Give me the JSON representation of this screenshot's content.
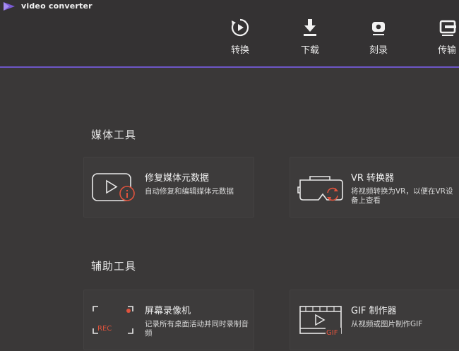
{
  "app": {
    "title": "video converter"
  },
  "toolbar": {
    "items": [
      {
        "label": "转换",
        "icon": "convert-icon"
      },
      {
        "label": "下载",
        "icon": "download-icon"
      },
      {
        "label": "刻录",
        "icon": "burn-disc-icon"
      },
      {
        "label": "传输",
        "icon": "transfer-icon"
      }
    ]
  },
  "sections": {
    "media": {
      "title": "媒体工具",
      "cards": [
        {
          "title": "修复媒体元数据",
          "desc": "自动修复和编辑媒体元数据",
          "icon": "fix-metadata-icon"
        },
        {
          "title": "VR 转换器",
          "desc": "将视频转换为VR，以便在VR设备上查看",
          "icon": "vr-headset-icon"
        }
      ]
    },
    "aux": {
      "title": "辅助工具",
      "cards": [
        {
          "title": "屏幕录像机",
          "desc": "记录所有桌面活动并同时录制音频",
          "icon": "screen-recorder-icon",
          "badge": "REC"
        },
        {
          "title": "GIF 制作器",
          "desc": "从视频或图片制作GIF",
          "icon": "gif-maker-icon",
          "badge": "GIF"
        }
      ]
    }
  },
  "colors": {
    "accent": "#6d56c7",
    "icon_red": "#e0533d",
    "background": "#3a3838",
    "header": "#343233"
  }
}
